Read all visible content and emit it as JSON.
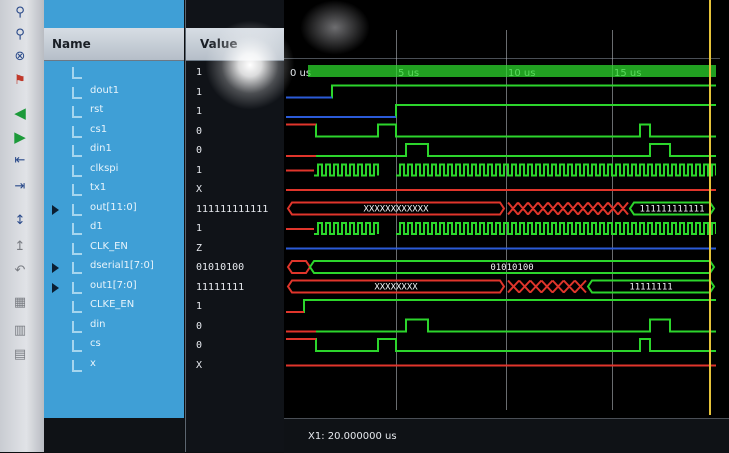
{
  "header": {
    "name_label": "Name",
    "value_label": "Value"
  },
  "time_ticks": [
    "0 us",
    "5 us",
    "10 us",
    "15 us"
  ],
  "signals": [
    {
      "name": "",
      "value": "1",
      "expandable": false
    },
    {
      "name": "dout1",
      "value": "1",
      "expandable": false
    },
    {
      "name": "rst",
      "value": "1",
      "expandable": false
    },
    {
      "name": "cs1",
      "value": "0",
      "expandable": false
    },
    {
      "name": "din1",
      "value": "0",
      "expandable": false
    },
    {
      "name": "clkspi",
      "value": "1",
      "expandable": false
    },
    {
      "name": "tx1",
      "value": "X",
      "expandable": false
    },
    {
      "name": "out[11:0]",
      "value": "111111111111",
      "expandable": true
    },
    {
      "name": "d1",
      "value": "1",
      "expandable": false
    },
    {
      "name": "CLK_EN",
      "value": "Z",
      "expandable": false
    },
    {
      "name": "dserial1[7:0]",
      "value": "01010100",
      "expandable": true
    },
    {
      "name": "out1[7:0]",
      "value": "11111111",
      "expandable": true
    },
    {
      "name": "CLKE_EN",
      "value": "1",
      "expandable": false
    },
    {
      "name": "din",
      "value": "0",
      "expandable": false
    },
    {
      "name": "cs",
      "value": "0",
      "expandable": false
    },
    {
      "name": "x",
      "value": "X",
      "expandable": false
    }
  ],
  "bus_labels": {
    "out_first": "XXXXXXXXXXXX",
    "out_last": "111111111111",
    "dserial": "01010100",
    "out1_first": "XXXXXXXX",
    "out1_last": "11111111"
  },
  "status": {
    "cursor_readout": "X1: 20.000000 us"
  },
  "toolbar_icons": [
    "zoom-in-icon",
    "zoom-fit-icon",
    "marker-icon",
    "go-start-icon",
    "go-end-icon",
    "step-back-icon",
    "step-forward-icon",
    "add-signal-icon",
    "cursor-icon",
    "undo-icon",
    "grid-icon",
    "snap-icon",
    "settings-icon"
  ],
  "colors": {
    "signal_green": "#2cd52c",
    "signal_red": "#e0352b",
    "signal_blue": "#2b5bd8",
    "name_column_bg": "#3f9fd6",
    "cursor_yellow": "#e6c23a"
  }
}
